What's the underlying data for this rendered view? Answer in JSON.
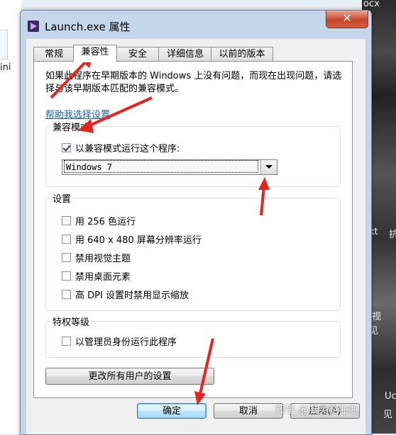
{
  "background": {
    "left_text": "ini",
    "right_texts": [
      "ocx",
      "kt",
      "抗",
      "视",
      "见",
      "Uc",
      "见"
    ]
  },
  "window": {
    "title": "Launch.exe 属性",
    "close_icon": "close-icon",
    "tabs": [
      {
        "label": "常规",
        "active": false
      },
      {
        "label": "兼容性",
        "active": true
      },
      {
        "label": "安全",
        "active": false
      },
      {
        "label": "详细信息",
        "active": false
      },
      {
        "label": "以前的版本",
        "active": false
      }
    ],
    "description": "如果此程序在早期版本的 Windows 上没有问题，而现在出现问题，请选择与该早期版本匹配的兼容模式。",
    "help_link": "帮助我选择设置",
    "compat_group": {
      "label": "兼容模式",
      "checkbox_label": "以兼容模式运行这个程序:",
      "checked": true,
      "select_value": "Windows 7"
    },
    "settings_group": {
      "label": "设置",
      "options": [
        {
          "label": "用 256 色运行",
          "checked": false
        },
        {
          "label": "用 640 x 480 屏幕分辨率运行",
          "checked": false
        },
        {
          "label": "禁用视觉主题",
          "checked": false
        },
        {
          "label": "禁用桌面元素",
          "checked": false
        },
        {
          "label": "高 DPI 设置时禁用显示缩放",
          "checked": false
        }
      ]
    },
    "privilege_group": {
      "label": "特权等级",
      "checkbox_label": "以管理员身份运行此程序",
      "checked": false
    },
    "all_users_button": "更改所有用户的设置",
    "ok_button": "确定",
    "cancel_button": "取消",
    "apply_button": "应用(A)"
  },
  "watermark": "知乎 @凝灵啊啪啪",
  "colors": {
    "link": "#1660a8",
    "annotation_arrow": "#e8231d",
    "title_bar": "#c6d6ea"
  }
}
